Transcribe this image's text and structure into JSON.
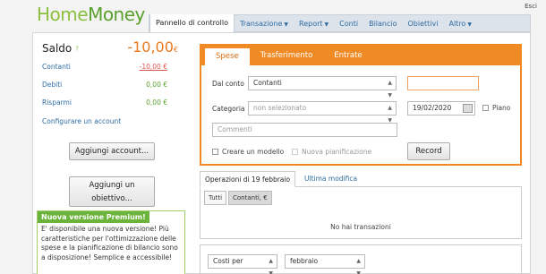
{
  "app": {
    "logo_home": "Home",
    "logo_money": "Money",
    "exit": "Esci"
  },
  "nav": {
    "tabs": [
      {
        "label": "Pannello di controllo"
      },
      {
        "label": "Transazione",
        "caret": "▼"
      },
      {
        "label": "Report",
        "caret": "▼"
      },
      {
        "label": "Conti"
      },
      {
        "label": "Bilancio"
      },
      {
        "label": "Obiettivi"
      },
      {
        "label": "Altro",
        "caret": "▼"
      }
    ]
  },
  "left": {
    "saldo_label": "Saldo",
    "saldo_help": "?",
    "saldo_value": "-10,00",
    "saldo_currency": "€",
    "accounts": [
      {
        "name": "Contanti",
        "value": "-10,00 €"
      },
      {
        "name": "Debiti",
        "value": "0,00 €"
      },
      {
        "name": "Risparmi",
        "value": "0,00 €"
      }
    ],
    "configure": "Configurare un account",
    "add_account": "Aggiungi account...",
    "add_goal_1": "Aggiungi un",
    "add_goal_2": "obiettivo...",
    "promo_title": "Nuova versione Premium!",
    "promo_text": "E' disponibile una nuova versione! Più caratteristiche per l'ottimizzazione delle spese e la pianificazione di bilancio sono a disposizione! Semplice e accessibile!"
  },
  "form": {
    "tabs": [
      "Spese",
      "Trasferimento",
      "Entrate"
    ],
    "from_label": "Dal conto",
    "from_value": "Contanti",
    "category_label": "Categoria",
    "category_value": "non selezionato",
    "amount_value": "",
    "date_value": "19/02/2020",
    "plan_label": "Piano",
    "comment_placeholder": "Commenti",
    "create_template": "Creare un modello",
    "new_plan": "Nuova pianificazione",
    "record": "Record"
  },
  "ops": {
    "tab_active": "Operazioni di 19 febbraio",
    "tab_other": "Ultima modifica",
    "filter_all": "Tutti",
    "filter_cash": "Contanti, €",
    "empty": "No hai transazioni"
  },
  "costs": {
    "type_value": "Costi per",
    "month_value": "febbraio"
  },
  "colors": {
    "orange": "#f08a24",
    "green": "#6bb33a",
    "link": "#2e6da4"
  }
}
